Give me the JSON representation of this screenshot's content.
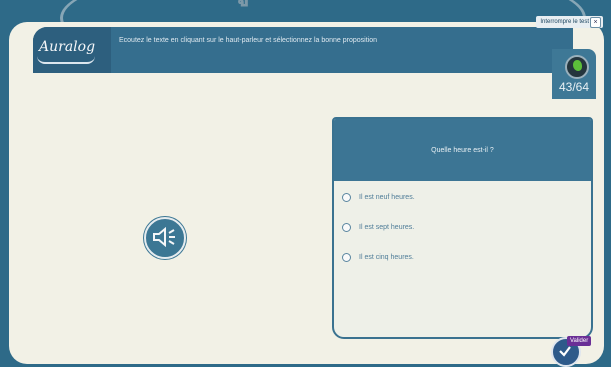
{
  "watermark": "ฯอมูกล่าไ",
  "toolbar": {
    "interrupt_label": "Interrompre le test",
    "close_glyph": "×"
  },
  "header": {
    "logo": "Auralog",
    "instruction": "Ecoutez le texte en cliquant sur le haut-parleur et sélectionnez la bonne proposition",
    "progress": "43/64"
  },
  "question": {
    "prompt": "Quelle heure est-il ?",
    "options": [
      "Il est neuf heures.",
      "Il est sept heures.",
      "Il est cinq heures."
    ]
  },
  "validate": {
    "tooltip": "Valider"
  },
  "colors": {
    "primary": "#356e8e",
    "panel": "#f2f1e6",
    "accent": "#6a2f96"
  }
}
